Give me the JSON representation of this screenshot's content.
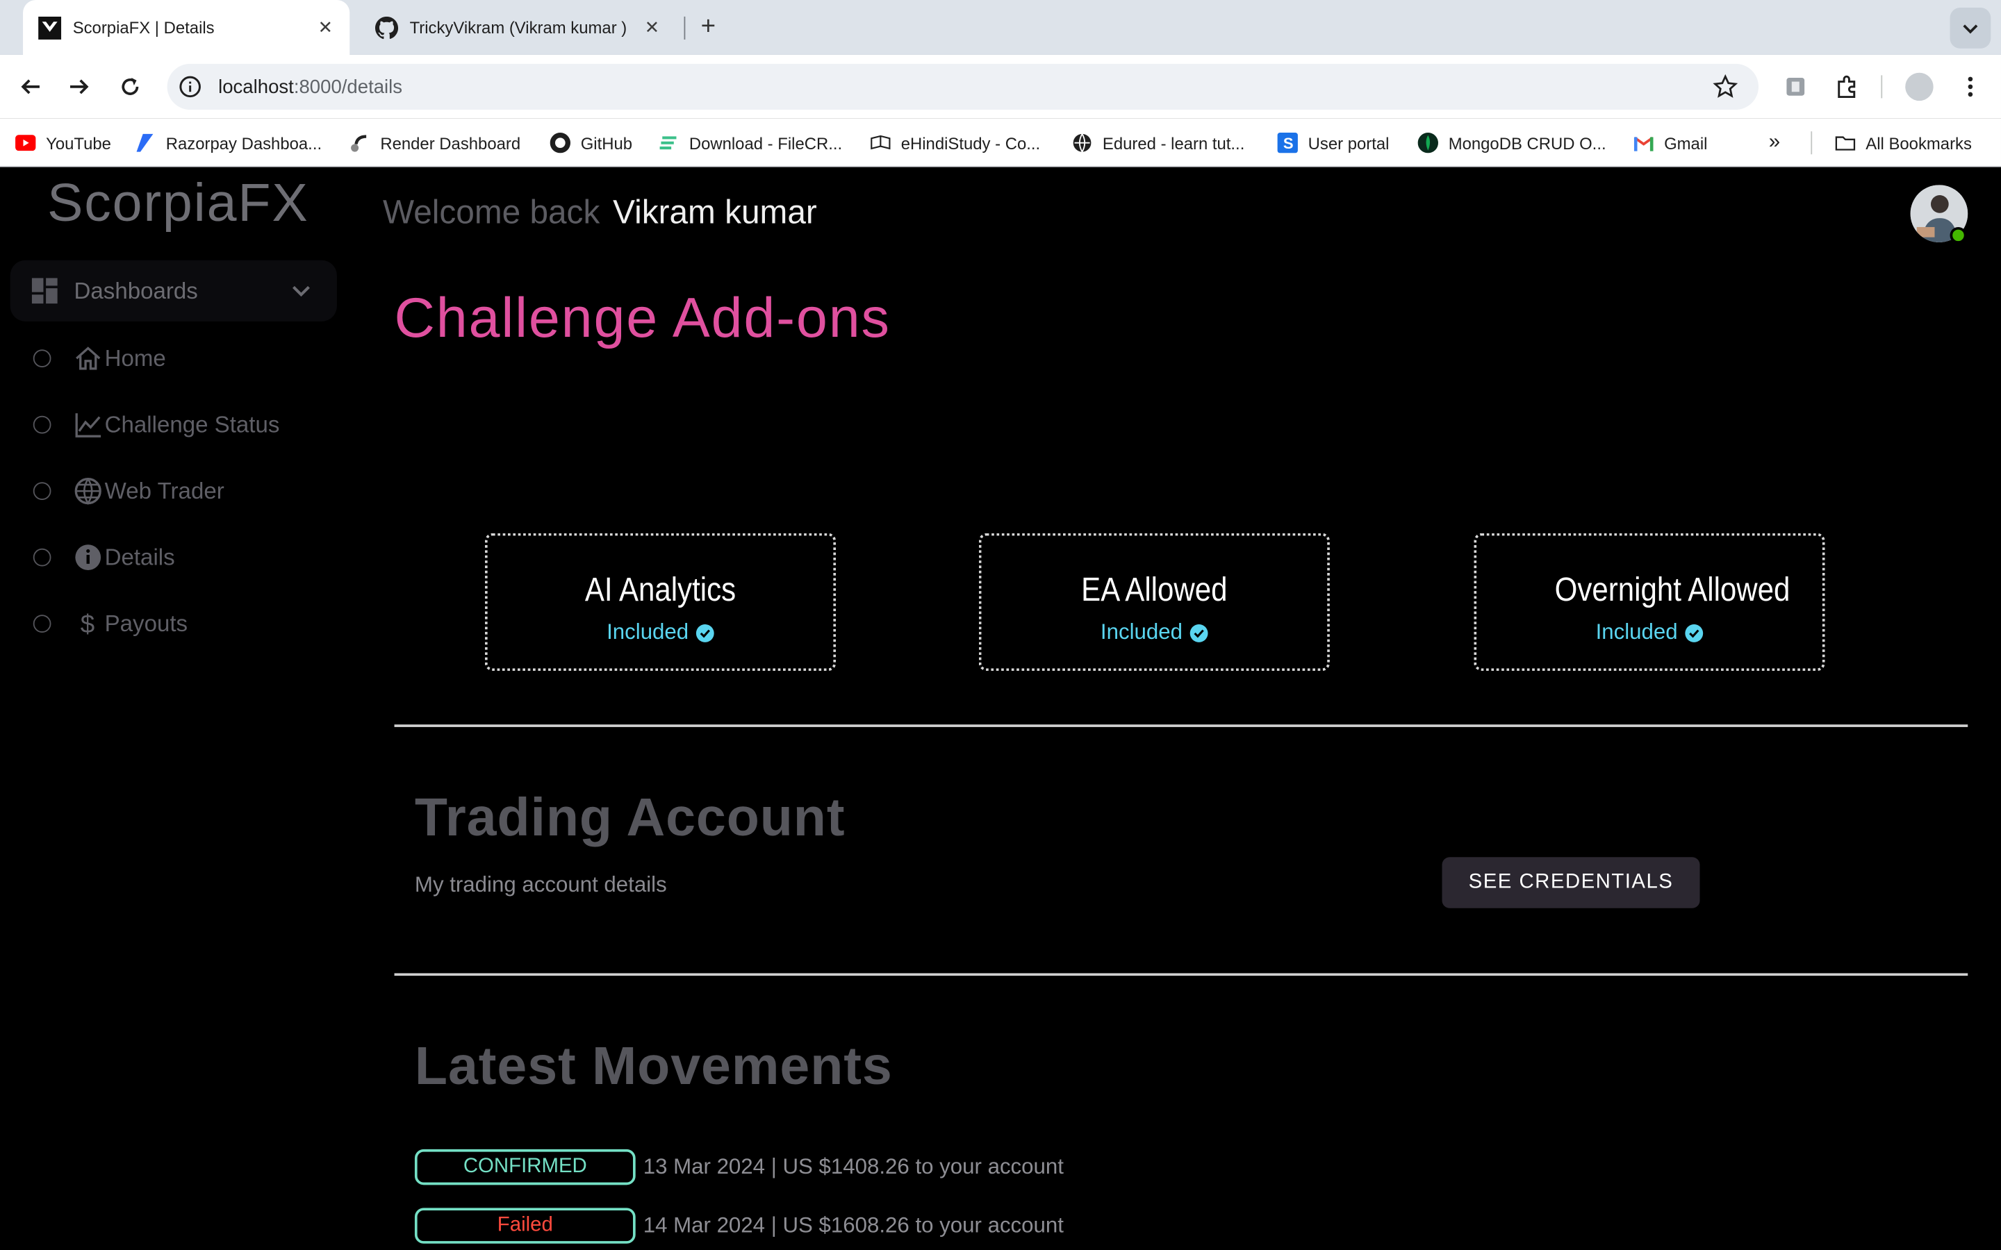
{
  "browser": {
    "tabs": [
      {
        "title": "ScorpiaFX | Details",
        "active": true
      },
      {
        "title": "TrickyVikram (Vikram kumar )",
        "active": false
      }
    ],
    "url_host": "localhost",
    "url_path": ":8000/details",
    "bookmarks": [
      {
        "label": "YouTube",
        "icon": "youtube-icon"
      },
      {
        "label": "Razorpay Dashboa...",
        "icon": "razorpay-icon"
      },
      {
        "label": "Render Dashboard",
        "icon": "render-icon"
      },
      {
        "label": "GitHub",
        "icon": "github-icon"
      },
      {
        "label": "Download - FileCR...",
        "icon": "filecr-icon"
      },
      {
        "label": "eHindiStudy - Co...",
        "icon": "ehindistudy-icon"
      },
      {
        "label": "Edured - learn tut...",
        "icon": "globe-icon"
      },
      {
        "label": "User portal",
        "icon": "s-icon"
      },
      {
        "label": "MongoDB CRUD O...",
        "icon": "mongodb-icon"
      },
      {
        "label": "Gmail",
        "icon": "gmail-icon"
      }
    ],
    "all_bookmarks": "All Bookmarks"
  },
  "sidebar": {
    "brand": "ScorpiaFX",
    "group_label": "Dashboards",
    "items": [
      {
        "label": "Home",
        "icon": "home-icon"
      },
      {
        "label": "Challenge Status",
        "icon": "chart-line-icon"
      },
      {
        "label": "Web Trader",
        "icon": "globe-icon"
      },
      {
        "label": "Details",
        "icon": "info-icon"
      },
      {
        "label": "Payouts",
        "icon": "dollar-icon"
      }
    ]
  },
  "header": {
    "welcome": "Welcome back",
    "user_name": "Vikram kumar"
  },
  "addons": {
    "heading": "Challenge Add-ons",
    "cards": [
      {
        "title": "AI Analytics",
        "status": "Included"
      },
      {
        "title": "EA Allowed",
        "status": "Included"
      },
      {
        "title": "Overnight Allowed",
        "status": "Included"
      }
    ]
  },
  "trading_account": {
    "heading": "Trading Account",
    "subtitle": "My trading account details",
    "button": "SEE CREDENTIALS"
  },
  "movements": {
    "heading": "Latest Movements",
    "items": [
      {
        "status": "CONFIRMED",
        "status_color": "#74e0c5",
        "text": "13 Mar 2024 | US $1408.26 to your account"
      },
      {
        "status": "Failed",
        "status_color": "#ff4a3d",
        "text": "14 Mar 2024 | US $1608.26 to your account"
      }
    ]
  },
  "colors": {
    "accent_pink": "#e0509f",
    "included_cyan": "#5ad5f0",
    "online_green": "#44b700"
  }
}
